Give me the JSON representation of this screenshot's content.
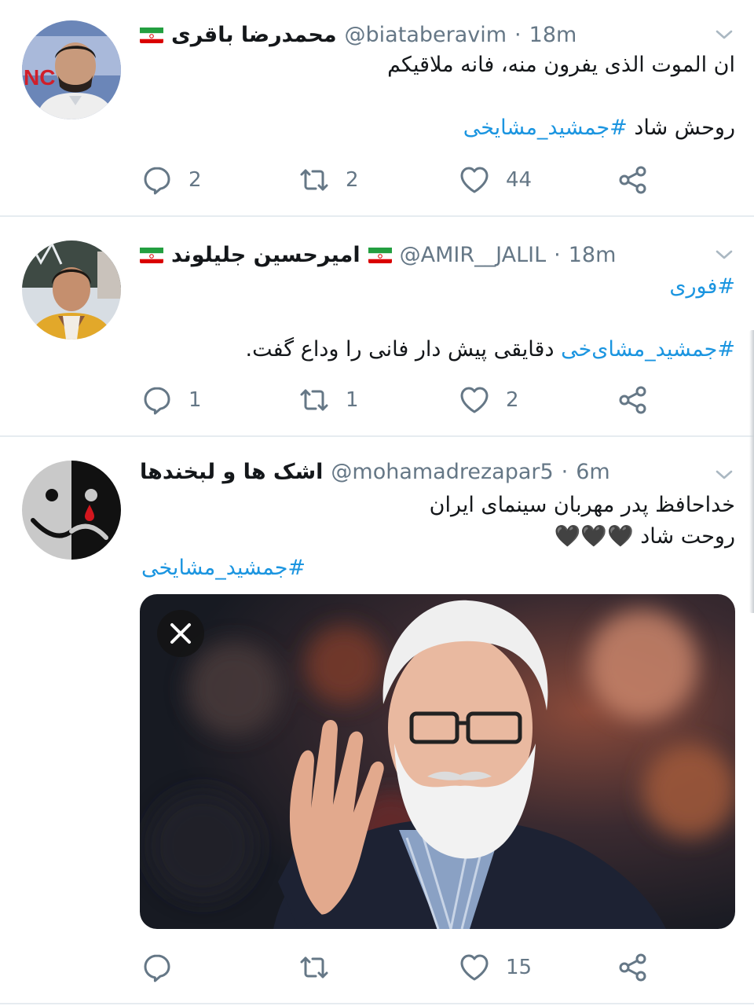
{
  "tweets": [
    {
      "name": "محمدرضا باقری",
      "handle": "@biataberavim",
      "time": "18m",
      "lines": [
        "ان الموت الذی یفرون منه، فانه ملاقیکم"
      ],
      "hashtag_line": {
        "prefix": "روحش شاد ",
        "hashtag": "#جمشید_مشایخی"
      },
      "counts": {
        "reply": "2",
        "retweet": "2",
        "like": "44"
      }
    },
    {
      "name": "امیرحسین جلیلوند",
      "handle": "@AMIR__JALIL",
      "time": "18m",
      "tag_line": "#فوری",
      "body": {
        "hashtag": "#جمشید_مشای‌خی",
        "rest": " دقایقی پیش دار فانی را وداع گفت."
      },
      "counts": {
        "reply": "1",
        "retweet": "1",
        "like": "2"
      }
    },
    {
      "name": "اشک ها و لبخندها",
      "handle": "@mohamadrezapar5",
      "time": "6m",
      "lines": [
        "خداحافظ پدر مهربان سینمای ایران",
        "روحت شاد 🖤🖤🖤"
      ],
      "hashtag": "#جمشید_مشایخی",
      "counts": {
        "reply": "",
        "retweet": "",
        "like": "15"
      }
    }
  ],
  "separator": "·",
  "colors": {
    "link": "#1b95e0",
    "meta": "#657786",
    "divider": "#e6ecf0"
  },
  "icons": [
    "reply-icon",
    "retweet-icon",
    "like-icon",
    "share-icon",
    "chevron-down-icon",
    "close-icon",
    "iran-flag-icon"
  ]
}
